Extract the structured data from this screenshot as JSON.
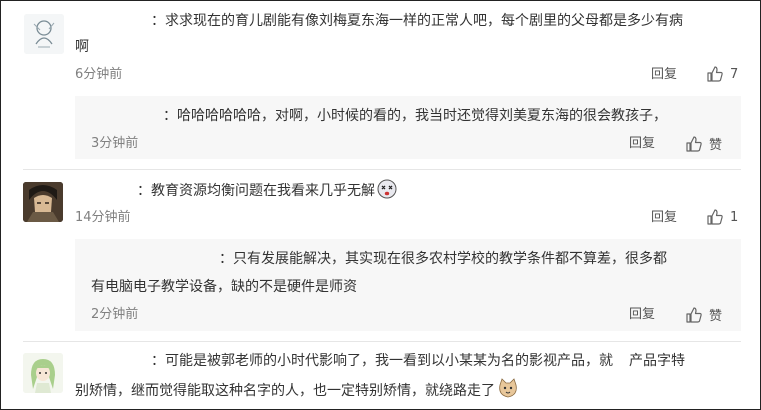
{
  "comments": [
    {
      "text_line1": "：求求现在的育儿剧能有像刘梅夏东海一样的正常人吧，每个剧里的父母都是多少有病",
      "text_line2": "啊",
      "time": "6分钟前",
      "reply_label": "回复",
      "like_count": "7",
      "avatar_icon": "sketch-avatar-icon"
    },
    {
      "text_line1": "：教育资源均衡问题在我看来几乎无解",
      "time": "14分钟前",
      "reply_label": "回复",
      "like_count": "1",
      "avatar_icon": "anime-character-avatar-icon",
      "emoji": "dizzy-face-emoji"
    },
    {
      "text_line1": "：可能是被郭老师的小时代影响了，我一看到以小某某为名的影视产品，就",
      "text_line1_tail": "产品字特",
      "text_line2": "别矫情，继而觉得能取这种名字的人，也一定特别矫情，就绕路走了",
      "avatar_icon": "green-hair-avatar-icon",
      "emoji": "cat-face-emoji"
    }
  ],
  "replies": [
    {
      "text_line1": "：哈哈哈哈哈哈，对啊，小时候的看的，我当时还觉得刘美夏东海的很会教孩子，",
      "time": "3分钟前",
      "reply_label": "回复",
      "like_label": "赞"
    },
    {
      "text_line1": "：只有发展能解决，其实现在很多农村学校的教学条件都不算差，很多都",
      "text_line2": "有电脑电子教学设备，缺的不是硬件是师资",
      "time": "2分钟前",
      "reply_label": "回复",
      "like_label": "赞"
    }
  ],
  "colors": {
    "time": "#808080",
    "text": "#333333",
    "subbox": "#f7f7f7"
  }
}
